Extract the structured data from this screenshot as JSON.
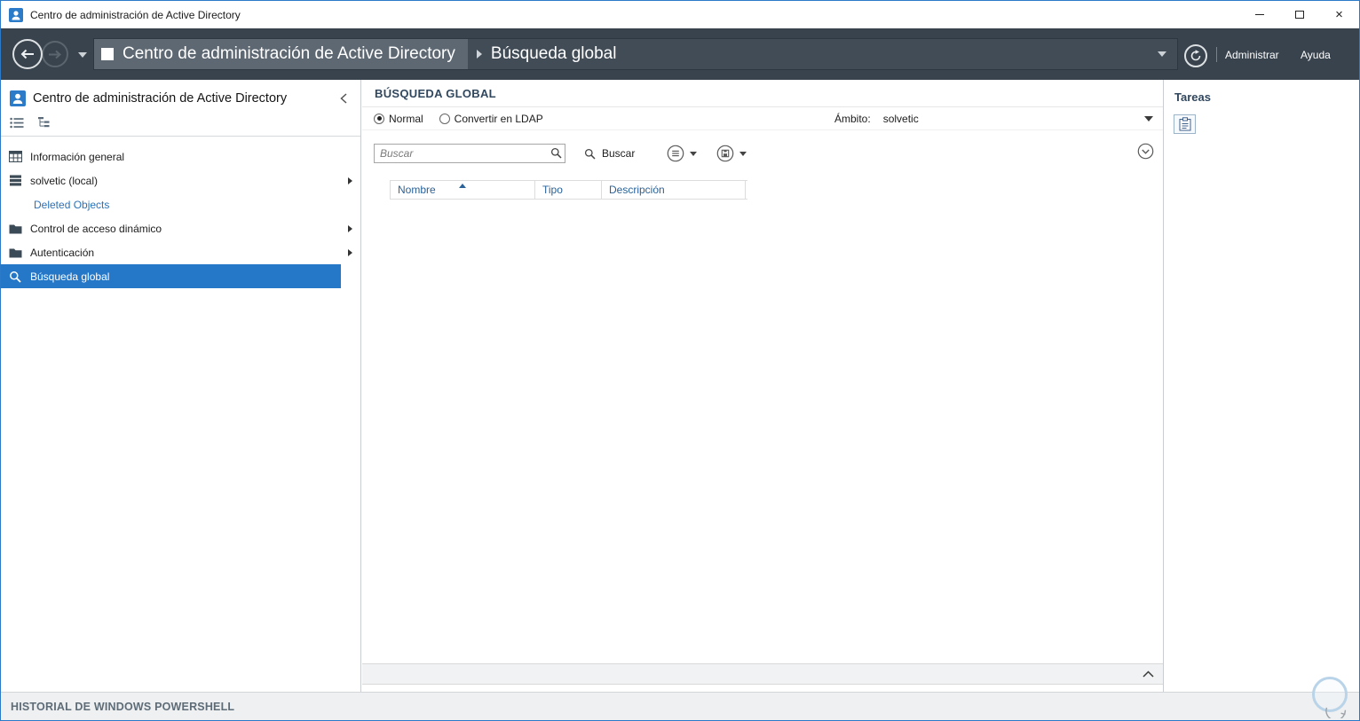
{
  "window": {
    "title": "Centro de administración de Active Directory",
    "close_glyph": "×"
  },
  "navbar": {
    "breadcrumb_root": "Centro de administración de Active Directory",
    "breadcrumb_current": "Búsqueda global",
    "administrar": "Administrar",
    "ayuda": "Ayuda"
  },
  "sidebar": {
    "title": "Centro de administración de Active Directory",
    "items": [
      {
        "label": "Información general"
      },
      {
        "label": "solvetic (local)"
      },
      {
        "label": "Deleted Objects"
      },
      {
        "label": "Control de acceso dinámico"
      },
      {
        "label": "Autenticación"
      },
      {
        "label": "Búsqueda global"
      }
    ]
  },
  "main": {
    "title": "BÚSQUEDA GLOBAL",
    "filter": {
      "normal": "Normal",
      "ldap": "Convertir en LDAP",
      "scope_label": "Ámbito:",
      "scope_value": "solvetic"
    },
    "search": {
      "placeholder": "Buscar",
      "button": "Buscar"
    },
    "table": {
      "columns": [
        "Nombre",
        "Tipo",
        "Descripción"
      ]
    }
  },
  "tasks": {
    "title": "Tareas"
  },
  "statusbar": {
    "title": "HISTORIAL DE WINDOWS POWERSHELL"
  },
  "colors": {
    "accent": "#2577c8",
    "navbar_bg": "#39434d",
    "breadcrumb_segment_bg": "#5d6873",
    "selection_bg": "#2577c8",
    "link_text": "#2b71b8",
    "section_header_text": "#31475e",
    "column_header_text": "#2b6298",
    "statusbar_bg": "#eef0f1"
  },
  "icons": {
    "back": "arrow-left-circle",
    "forward": "arrow-right-circle",
    "history_dropdown": "caret-down",
    "breadcrumb_separator": "chevron-right",
    "refresh": "circular-arrow",
    "search": "magnifier",
    "saved_queries": "floppy-in-circle",
    "query_options": "list-in-circle",
    "expand_panel": "chevron-down-in-circle",
    "collapse_preview": "chevron-up",
    "sidebar_collapse": "chevron-left",
    "sort_ascending": "triangle-up"
  }
}
